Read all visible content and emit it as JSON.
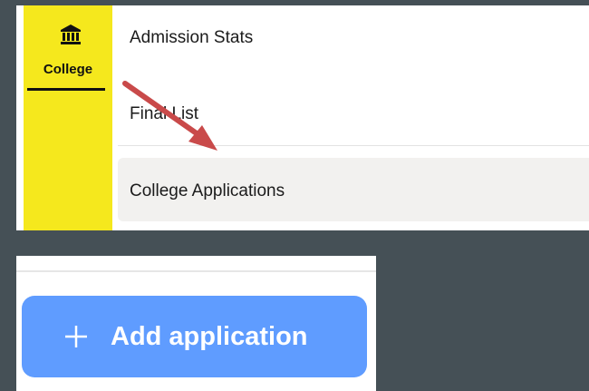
{
  "sidebar": {
    "college_label": "College",
    "icon": "bank-building-icon"
  },
  "menu": {
    "items": [
      {
        "label": "Admission Stats"
      },
      {
        "label": "Final List"
      },
      {
        "label": "College Applications",
        "selected": true
      }
    ]
  },
  "actions": {
    "add_application_label": "Add application",
    "add_icon": "plus-icon"
  },
  "colors": {
    "background": "#455056",
    "rail": "#f5e81d",
    "selected_row": "#f2f1ef",
    "button": "#5f9cff",
    "arrow": "#c94a4a"
  }
}
